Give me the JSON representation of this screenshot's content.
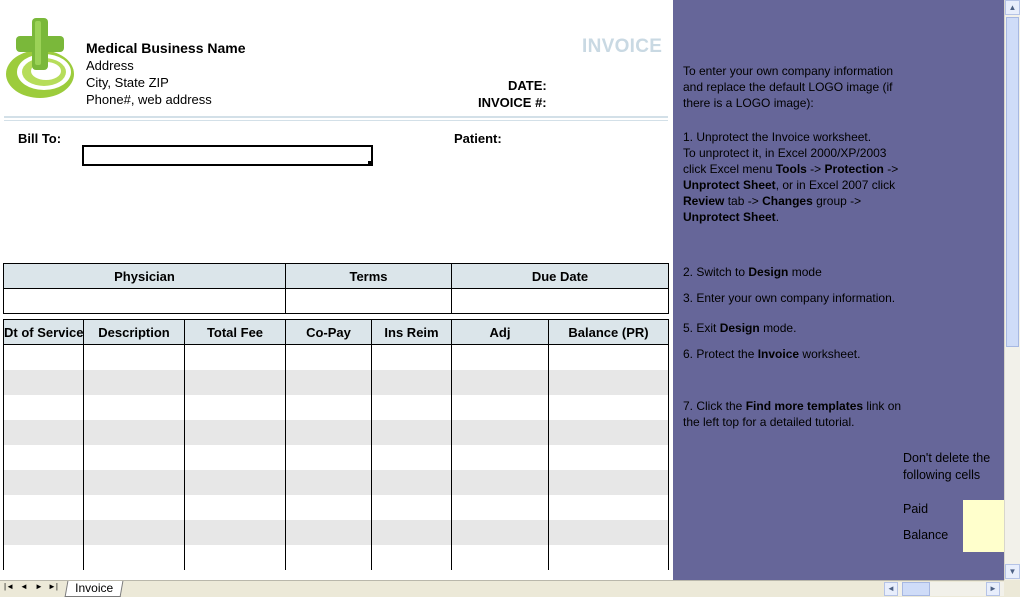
{
  "invoice": {
    "company": {
      "name": "Medical Business Name",
      "address": "Address",
      "city": "City, State ZIP",
      "phone": "Phone#, web address"
    },
    "title": "INVOICE",
    "date_label": "DATE:",
    "invoice_no_label": "INVOICE #:",
    "bill_to_label": "Bill To:",
    "patient_label": "Patient:",
    "info_headers": [
      "Physician",
      "Terms",
      "Due Date"
    ],
    "item_headers": [
      "Dt of Service",
      "Description",
      "Total Fee",
      "Co-Pay",
      "Ins Reim",
      "Adj",
      "Balance (PR)"
    ]
  },
  "panel": {
    "intro": "To enter your own company information and replace the default LOGO image (if there is a LOGO image):",
    "step1a": "1. Unprotect the Invoice worksheet.",
    "step1b": "To unprotect it, in Excel 2000/XP/2003 click Excel menu",
    "tools": "Tools",
    "arrow1": "->",
    "protection": "Protection",
    "arrow2": "->",
    "unprotect_sheet": "Unprotect Sheet",
    "or_excel2007": ", or in Excel 2007 click",
    "review": "Review",
    "tab_arrow": "tab ->",
    "changes": "Changes",
    "group_arrow": "group ->",
    "unprotect_sheet2": "Unprotect Sheet",
    "period": ".",
    "step2_pre": "2. Switch to",
    "design": "Design",
    "step2_post": "mode",
    "step3": "3. Enter your own company information.",
    "step5_pre": "5. Exit",
    "design2": "Design",
    "step5_post": "mode.",
    "step6_pre": "6. Protect the",
    "invoice_word": "Invoice",
    "step6_post": "worksheet.",
    "step7_pre": "7. Click the",
    "find_more": "Find more templates",
    "step7_post": "link on the left top for a detailed tutorial.",
    "dont_delete": "Don't delete the following cells",
    "paid": "Paid",
    "balance": "Balance"
  },
  "bottom": {
    "sheet_tab": "Invoice",
    "nav_first": "|◄",
    "nav_prev": "◄",
    "nav_next": "►",
    "nav_last": "►|"
  },
  "colors": {
    "panel_bg": "#666699",
    "header_bg": "#dbe5ea",
    "title_color": "#c9d9e3",
    "logo_green": "#8cc63f",
    "yellow_cell": "#ffffcc"
  }
}
